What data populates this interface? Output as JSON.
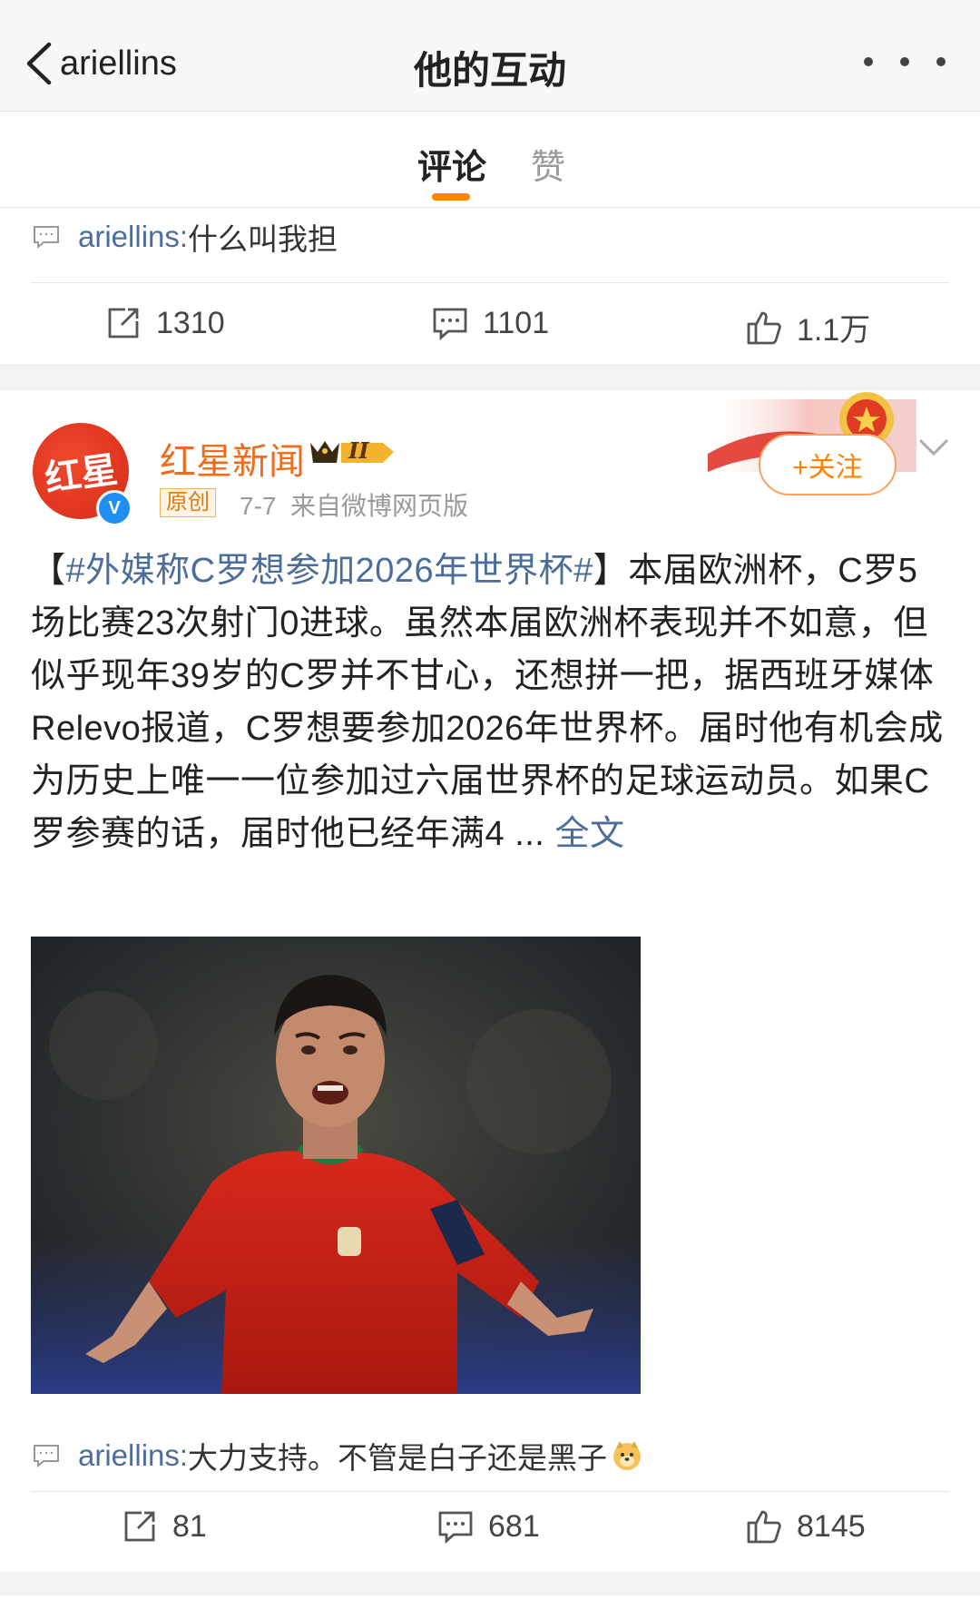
{
  "nav": {
    "back_label": "ariellins",
    "title": "他的互动",
    "more_icon": "more-dots-icon"
  },
  "tabs": [
    {
      "label": "评论",
      "active": true
    },
    {
      "label": "赞",
      "active": false
    }
  ],
  "accent_color": "#ff8200",
  "link_color": "#4b6d9c",
  "item1": {
    "comment": {
      "user": "ariellins",
      "sep": ": ",
      "text": "什么叫我担"
    },
    "repost_count": "1310",
    "comment_count": "1101",
    "like_count": "1.1万"
  },
  "item2": {
    "author": {
      "name": "红星新闻",
      "avatar_text": "红星",
      "verified": "V",
      "level_badge": "II"
    },
    "original_tag": "原创",
    "date": "7-7",
    "source": "来自微博网页版",
    "follow_label": "+关注",
    "body": {
      "open_bracket": "【",
      "topic": "#外媒称C罗想参加2026年世界杯#",
      "text": "】本届欧洲杯，C罗5场比赛23次射门0进球。虽然本届欧洲杯表现并不如意，但似乎现年39岁的C罗并不甘心，还想拼一把，据西班牙媒体Relevo报道，C罗想要参加2026年世界杯。届时他有机会成为历史上唯一一位参加过六届世界杯的足球运动员。如果C罗参赛的话，届时他已经年满4 ... ",
      "full_link": "全文"
    },
    "image_icon": "player-photo",
    "comment": {
      "user": "ariellins",
      "sep": ": ",
      "text": "大力支持。不管是白子还是黑子",
      "emoji": "doge-emoji-icon"
    },
    "repost_count": "81",
    "comment_count": "681",
    "like_count": "8145"
  }
}
